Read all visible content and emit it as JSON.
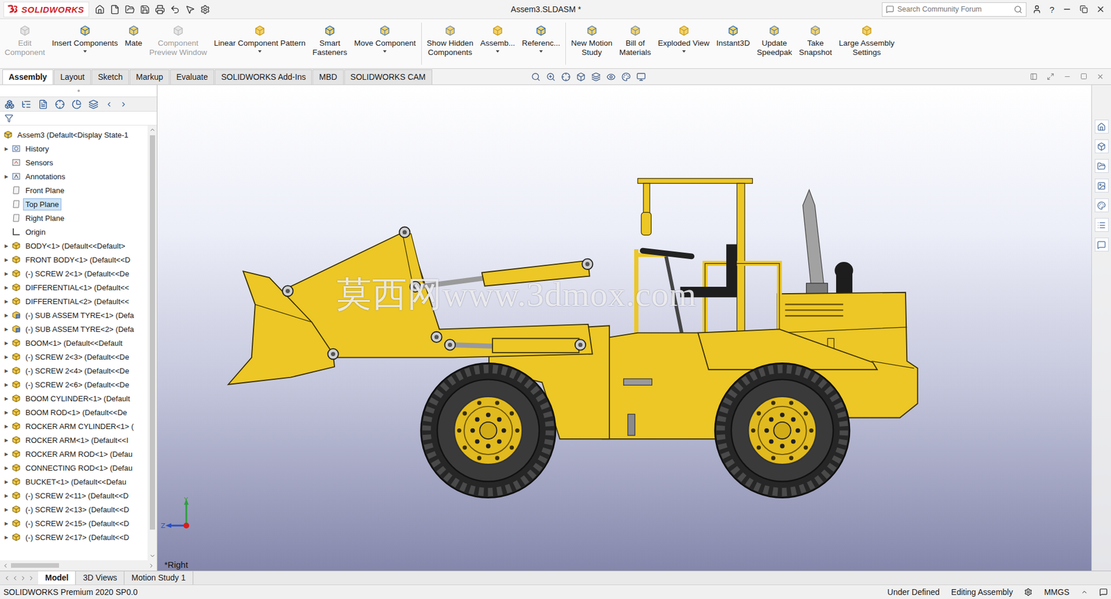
{
  "app": {
    "logo": "SOLIDWORKS",
    "title": "Assem3.SLDASM *",
    "search_placeholder": "Search Community Forum",
    "help": "?"
  },
  "ribbon": [
    {
      "lines": [
        "Edit",
        "Component"
      ],
      "disabled": true,
      "dropdown": false,
      "group": 1
    },
    {
      "lines": [
        "Insert Components"
      ],
      "disabled": false,
      "dropdown": true,
      "group": 1
    },
    {
      "lines": [
        "Mate"
      ],
      "disabled": false,
      "dropdown": false,
      "group": 1
    },
    {
      "lines": [
        "Component",
        "Preview Window"
      ],
      "disabled": true,
      "dropdown": false,
      "group": 1
    },
    {
      "lines": [
        "Linear Component Pattern"
      ],
      "disabled": false,
      "dropdown": true,
      "group": 1
    },
    {
      "lines": [
        "Smart",
        "Fasteners"
      ],
      "disabled": false,
      "dropdown": false,
      "group": 1
    },
    {
      "lines": [
        "Move Component"
      ],
      "disabled": false,
      "dropdown": true,
      "group": 1
    },
    {
      "lines": [
        "Show Hidden",
        "Components"
      ],
      "disabled": false,
      "dropdown": false,
      "group": 2
    },
    {
      "lines": [
        "Assemb..."
      ],
      "disabled": false,
      "dropdown": true,
      "group": 2
    },
    {
      "lines": [
        "Referenc..."
      ],
      "disabled": false,
      "dropdown": true,
      "group": 2
    },
    {
      "lines": [
        "New Motion",
        "Study"
      ],
      "disabled": false,
      "dropdown": false,
      "group": 3
    },
    {
      "lines": [
        "Bill of",
        "Materials"
      ],
      "disabled": false,
      "dropdown": false,
      "group": 3
    },
    {
      "lines": [
        "Exploded View"
      ],
      "disabled": false,
      "dropdown": true,
      "group": 3
    },
    {
      "lines": [
        "Instant3D"
      ],
      "disabled": false,
      "dropdown": false,
      "group": 3
    },
    {
      "lines": [
        "Update",
        "Speedpak"
      ],
      "disabled": false,
      "dropdown": false,
      "group": 3
    },
    {
      "lines": [
        "Take",
        "Snapshot"
      ],
      "disabled": false,
      "dropdown": false,
      "group": 3
    },
    {
      "lines": [
        "Large Assembly",
        "Settings"
      ],
      "disabled": false,
      "dropdown": false,
      "group": 3
    }
  ],
  "command_tabs": [
    {
      "label": "Assembly",
      "selected": true
    },
    {
      "label": "Layout",
      "selected": false
    },
    {
      "label": "Sketch",
      "selected": false
    },
    {
      "label": "Markup",
      "selected": false
    },
    {
      "label": "Evaluate",
      "selected": false
    },
    {
      "label": "SOLIDWORKS Add-Ins",
      "selected": false
    },
    {
      "label": "MBD",
      "selected": false
    },
    {
      "label": "SOLIDWORKS CAM",
      "selected": false
    }
  ],
  "tree": {
    "root": "Assem3  (Default<Display State-1",
    "items": [
      {
        "label": "History",
        "kind": "history",
        "expandable": true,
        "selected": false
      },
      {
        "label": "Sensors",
        "kind": "sensor",
        "expandable": false,
        "selected": false
      },
      {
        "label": "Annotations",
        "kind": "annotation",
        "expandable": true,
        "selected": false
      },
      {
        "label": "Front Plane",
        "kind": "plane",
        "expandable": false,
        "selected": false
      },
      {
        "label": "Top Plane",
        "kind": "plane",
        "expandable": false,
        "selected": true
      },
      {
        "label": "Right Plane",
        "kind": "plane",
        "expandable": false,
        "selected": false
      },
      {
        "label": "Origin",
        "kind": "origin",
        "expandable": false,
        "selected": false
      },
      {
        "label": "BODY<1> (Default<<Default>",
        "kind": "part",
        "expandable": true,
        "selected": false
      },
      {
        "label": "FRONT BODY<1> (Default<<D",
        "kind": "part",
        "expandable": true,
        "selected": false
      },
      {
        "label": "(-) SCREW 2<1> (Default<<De",
        "kind": "part",
        "expandable": true,
        "selected": false
      },
      {
        "label": "DIFFERENTIAL<1> (Default<<",
        "kind": "part",
        "expandable": true,
        "selected": false
      },
      {
        "label": "DIFFERENTIAL<2> (Default<<",
        "kind": "part",
        "expandable": true,
        "selected": false
      },
      {
        "label": "(-) SUB ASSEM TYRE<1> (Defa",
        "kind": "subassembly",
        "expandable": true,
        "selected": false
      },
      {
        "label": "(-) SUB ASSEM TYRE<2> (Defa",
        "kind": "subassembly",
        "expandable": true,
        "selected": false
      },
      {
        "label": "BOOM<1> (Default<<Default",
        "kind": "part",
        "expandable": true,
        "selected": false
      },
      {
        "label": "(-) SCREW 2<3> (Default<<De",
        "kind": "part",
        "expandable": true,
        "selected": false
      },
      {
        "label": "(-) SCREW 2<4> (Default<<De",
        "kind": "part",
        "expandable": true,
        "selected": false
      },
      {
        "label": "(-) SCREW 2<6> (Default<<De",
        "kind": "part",
        "expandable": true,
        "selected": false
      },
      {
        "label": "BOOM CYLINDER<1> (Default",
        "kind": "part",
        "expandable": true,
        "selected": false
      },
      {
        "label": "BOOM ROD<1> (Default<<De",
        "kind": "part",
        "expandable": true,
        "selected": false
      },
      {
        "label": "ROCKER ARM CYLINDER<1> (",
        "kind": "part",
        "expandable": true,
        "selected": false
      },
      {
        "label": "ROCKER ARM<1> (Default<<I",
        "kind": "part",
        "expandable": true,
        "selected": false
      },
      {
        "label": "ROCKER ARM ROD<1> (Defau",
        "kind": "part",
        "expandable": true,
        "selected": false
      },
      {
        "label": "CONNECTING ROD<1> (Defau",
        "kind": "part",
        "expandable": true,
        "selected": false
      },
      {
        "label": "BUCKET<1> (Default<<Defau",
        "kind": "part",
        "expandable": true,
        "selected": false
      },
      {
        "label": "(-) SCREW 2<11> (Default<<D",
        "kind": "part",
        "expandable": true,
        "selected": false
      },
      {
        "label": "(-) SCREW 2<13> (Default<<D",
        "kind": "part",
        "expandable": true,
        "selected": false
      },
      {
        "label": "(-) SCREW 2<15> (Default<<D",
        "kind": "part",
        "expandable": true,
        "selected": false
      },
      {
        "label": "(-) SCREW 2<17> (Default<<D",
        "kind": "part",
        "expandable": true,
        "selected": false
      }
    ]
  },
  "viewport": {
    "view_label": "*Right",
    "watermark": "莫西网www.3dmox.com",
    "axes": [
      "Y",
      "Z"
    ]
  },
  "bottom_tabs": [
    {
      "label": "Model",
      "selected": true
    },
    {
      "label": "3D Views",
      "selected": false
    },
    {
      "label": "Motion Study 1",
      "selected": false
    }
  ],
  "status_bar": {
    "product": "SOLIDWORKS Premium 2020 SP0.0",
    "state": "Under Defined",
    "mode": "Editing Assembly",
    "units": "MMGS"
  }
}
